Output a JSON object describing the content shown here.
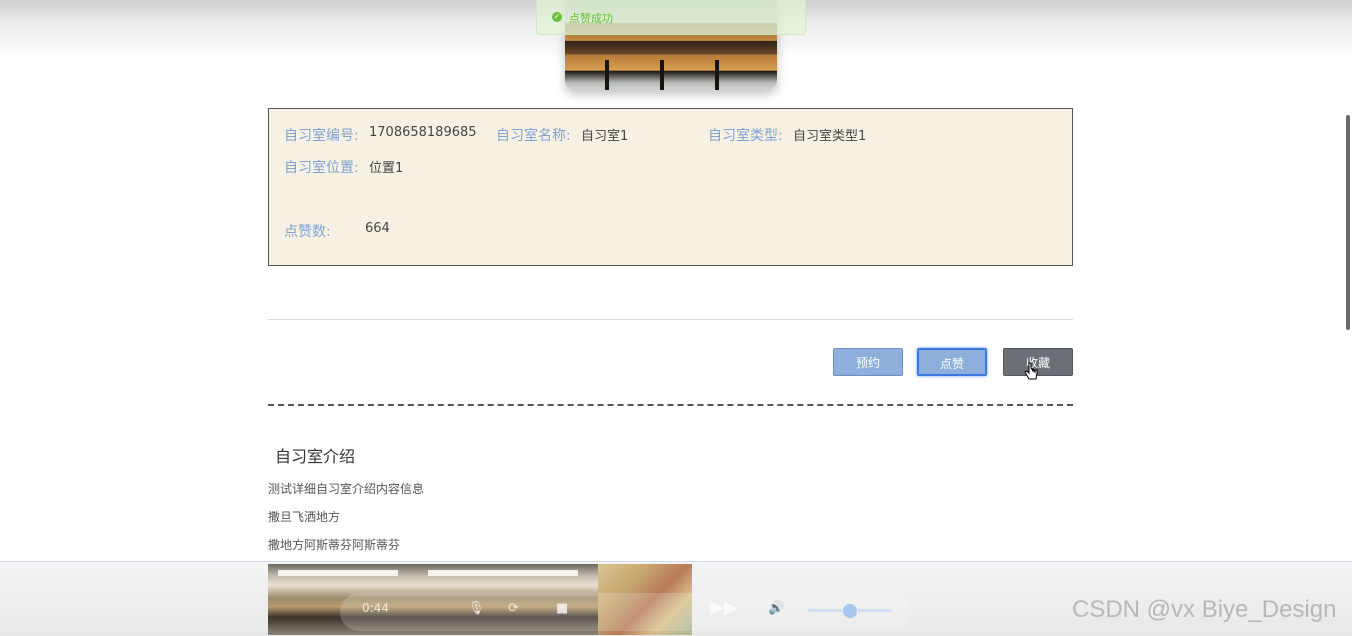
{
  "toast": {
    "message": "点赞成功",
    "icon": "success-check-icon",
    "color": "#67c23a"
  },
  "info": {
    "fields": [
      {
        "label": "自习室编号:",
        "value": "1708658189685"
      },
      {
        "label": "自习室名称:",
        "value": "自习室1"
      },
      {
        "label": "自习室类型:",
        "value": "自习室类型1"
      },
      {
        "label": "自习室位置:",
        "value": "位置1"
      },
      {
        "label": "点赞数:",
        "value": "664"
      }
    ],
    "label_color": "#7fa3d4",
    "background": "#f6f1e3"
  },
  "actions": {
    "reserve_label": "预约",
    "like_label": "点赞",
    "favorite_label": "收藏"
  },
  "intro": {
    "title": "自习室介绍",
    "lines": [
      "测试详细自习室介绍内容信息",
      "撒旦飞洒地方",
      "撒地方阿斯蒂芬阿斯蒂芬"
    ]
  },
  "player": {
    "time": "0:44"
  },
  "watermark": "CSDN @vx Biye_Design"
}
